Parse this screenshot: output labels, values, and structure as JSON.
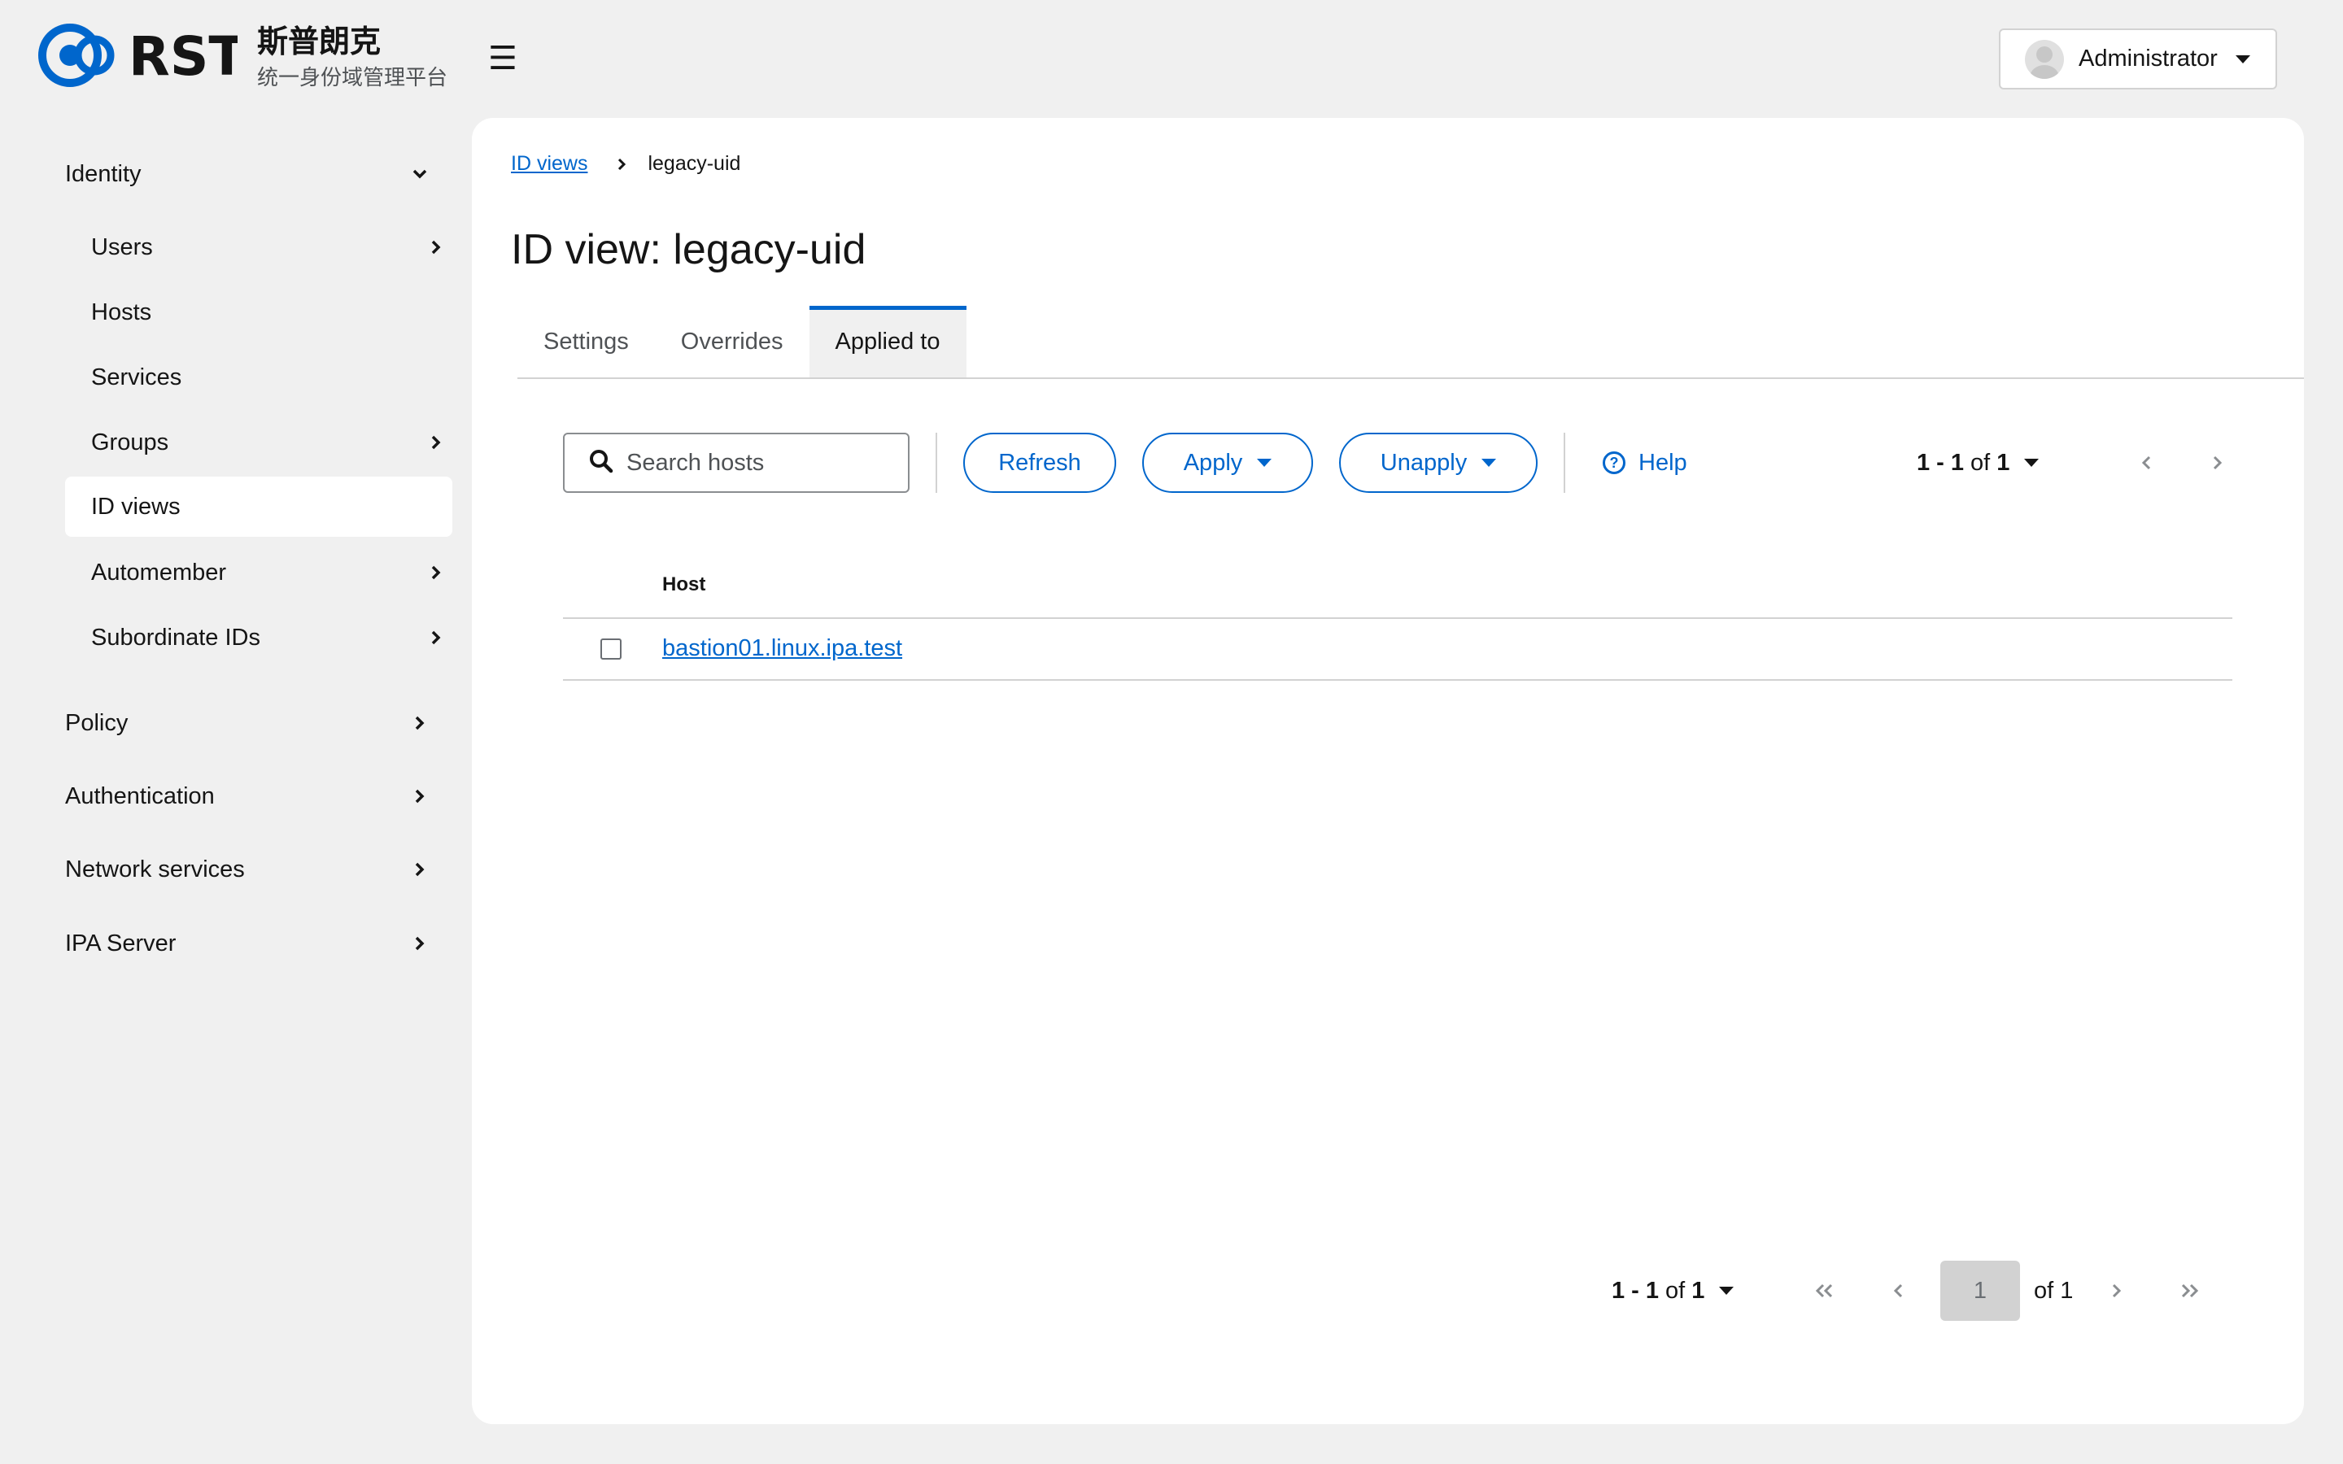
{
  "header": {
    "brand_name": "斯普朗克",
    "brand_subtitle": "统一身份域管理平台",
    "logo_text": "RST",
    "menu_icon": "hamburger-icon",
    "user": "Administrator"
  },
  "sidebar": {
    "identity": "Identity",
    "items": [
      {
        "label": "Users",
        "has_children": true
      },
      {
        "label": "Hosts",
        "has_children": false
      },
      {
        "label": "Services",
        "has_children": false
      },
      {
        "label": "Groups",
        "has_children": true
      },
      {
        "label": "ID views",
        "has_children": false,
        "active": true
      },
      {
        "label": "Automember",
        "has_children": true
      },
      {
        "label": "Subordinate IDs",
        "has_children": true
      }
    ],
    "sections": [
      {
        "label": "Policy"
      },
      {
        "label": "Authentication"
      },
      {
        "label": "Network services"
      },
      {
        "label": "IPA Server"
      }
    ]
  },
  "breadcrumb": {
    "parent": "ID views",
    "current": "legacy-uid"
  },
  "page": {
    "title": "ID view: legacy-uid"
  },
  "tabs": [
    {
      "label": "Settings",
      "active": false
    },
    {
      "label": "Overrides",
      "active": false
    },
    {
      "label": "Applied to",
      "active": true
    }
  ],
  "toolbar": {
    "search_placeholder": "Search hosts",
    "refresh": "Refresh",
    "apply": "Apply",
    "unapply": "Unapply",
    "help": "Help",
    "help_icon": "?"
  },
  "pagination_top": {
    "range": "1 - 1",
    "of_word": "of",
    "total": "1"
  },
  "table": {
    "columns": [
      "Host"
    ],
    "rows": [
      {
        "host": "bastion01.linux.ipa.test",
        "checked": false
      }
    ]
  },
  "pagination_bottom": {
    "range": "1 - 1",
    "of_word": "of",
    "total": "1",
    "current_page": "1",
    "of_pages": "of 1"
  },
  "colors": {
    "accent": "#0066cc",
    "background": "#f0f0f0",
    "panel": "#ffffff"
  }
}
